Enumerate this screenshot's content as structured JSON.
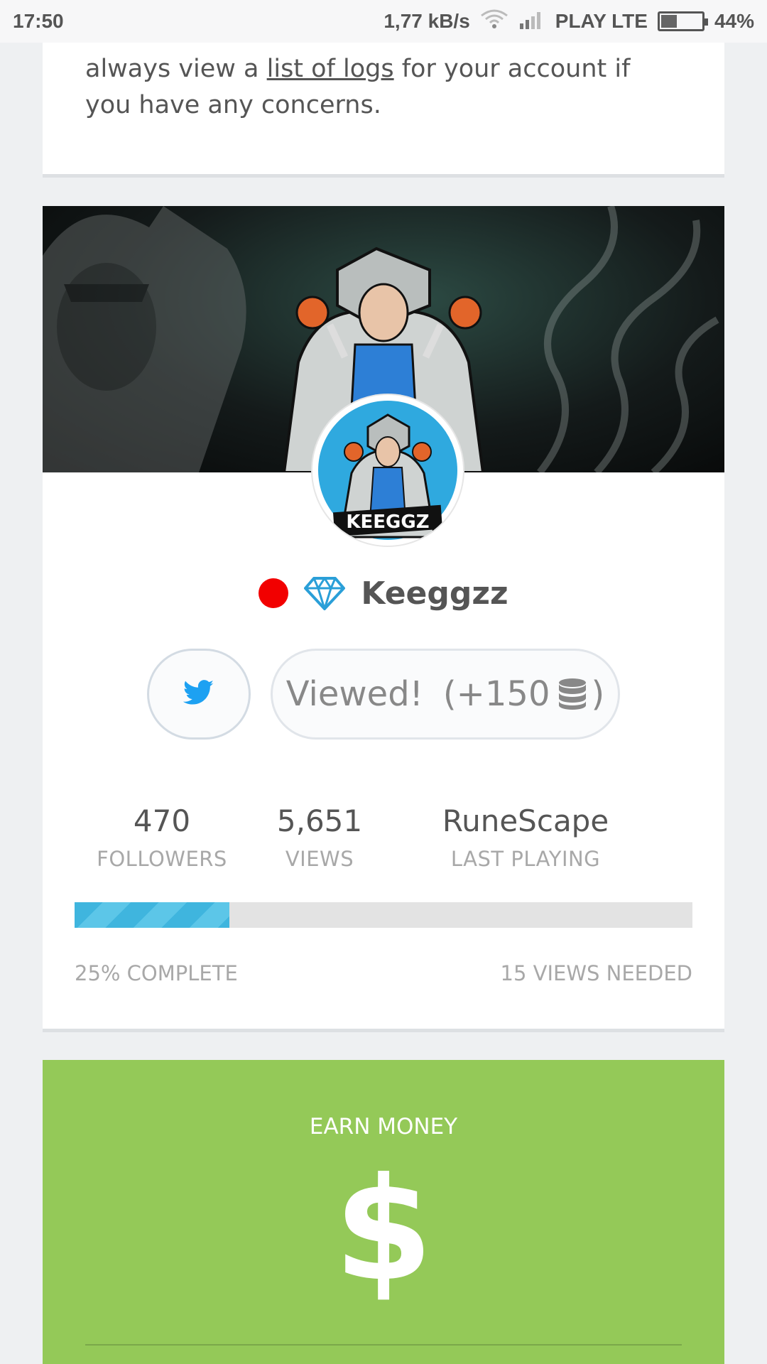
{
  "status_bar": {
    "time": "17:50",
    "network_speed": "1,77 kB/s",
    "carrier": "PLAY LTE",
    "battery": "44%",
    "battery_level": 0.44
  },
  "top_card": {
    "text_before_link": "always view a ",
    "link_text": "list of logs",
    "text_after_link": " for your account if you have any concerns."
  },
  "profile": {
    "username": "Keeggzz",
    "live_status_color": "#f20000",
    "badge_icon": "diamond-icon",
    "avatar_text": "KEEGGZ",
    "twitter_icon": "twitter-icon",
    "viewed_label": "Viewed!",
    "reward_open": "(+150",
    "reward_close": ")",
    "reward_icon": "coins-icon",
    "stats": {
      "followers_value": "470",
      "followers_label": "FOLLOWERS",
      "views_value": "5,651",
      "views_label": "VIEWS",
      "game_value": "RuneScape",
      "game_label": "LAST PLAYING"
    },
    "progress": {
      "fraction": 0.25,
      "complete_label": "25% COMPLETE",
      "needed_label": "15 VIEWS NEEDED"
    }
  },
  "earn_card": {
    "title": "EARN MONEY",
    "symbol": "$"
  },
  "colors": {
    "accent_blue": "#3fb5de",
    "earn_green": "#94c958",
    "twitter_blue": "#1da1f2"
  }
}
